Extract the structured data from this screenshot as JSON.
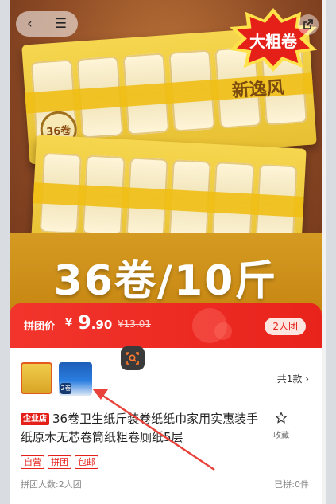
{
  "colors": {
    "accent_red": "#e52019",
    "price_bar": "#f2352c",
    "annotation_arrow": "#e8423a"
  },
  "hero": {
    "badge_text": "大粗卷",
    "pack_brand": "新逸风",
    "pack_count": "36卷",
    "volume_text": "36卷/10斤"
  },
  "nav": {
    "back_icon": "chevron-left-icon",
    "menu_icon": "menu-icon",
    "share_icon": "share-icon"
  },
  "price": {
    "label": "拼团价",
    "currency": "¥",
    "amount_int": "9",
    "amount_dec": ".90",
    "original": "¥13.01",
    "group_size": "2人团"
  },
  "product": {
    "variants_text": "共1款 ›",
    "shop_tag": "企业店",
    "title": "36卷卫生纸斤装卷纸纸巾家用实惠装手纸原木无芯卷筒纸粗卷厕纸5层",
    "fav_label": "收藏",
    "tags": [
      "自营",
      "拼团",
      "包邮"
    ],
    "group_count_text": "拼团人数:2人团",
    "sold_text": "已拼:0件",
    "thumb2_badge": "2卷"
  }
}
